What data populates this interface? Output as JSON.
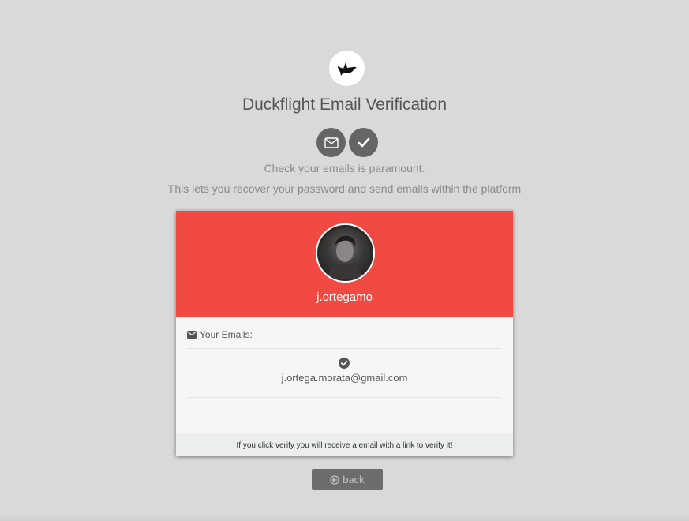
{
  "header": {
    "logo_icon": "bird-icon",
    "title": "Duckflight Email Verification",
    "steps": [
      {
        "icon": "envelope-icon"
      },
      {
        "icon": "check-icon"
      }
    ],
    "subtitle_line1": "Check your emails is paramount.",
    "subtitle_line2": "This lets you recover your password and send emails within the platform"
  },
  "card": {
    "header_color": "#f14a43",
    "username": "j.ortegamo",
    "emails_label": "Your Emails:",
    "emails": [
      {
        "address": "j.ortega.morata@gmail.com",
        "verified": true
      }
    ],
    "footer_text": "If you click verify you will receive a email with a link to verify it!"
  },
  "back_button": {
    "label": "back",
    "icon": "arrow-left-circle-icon"
  }
}
